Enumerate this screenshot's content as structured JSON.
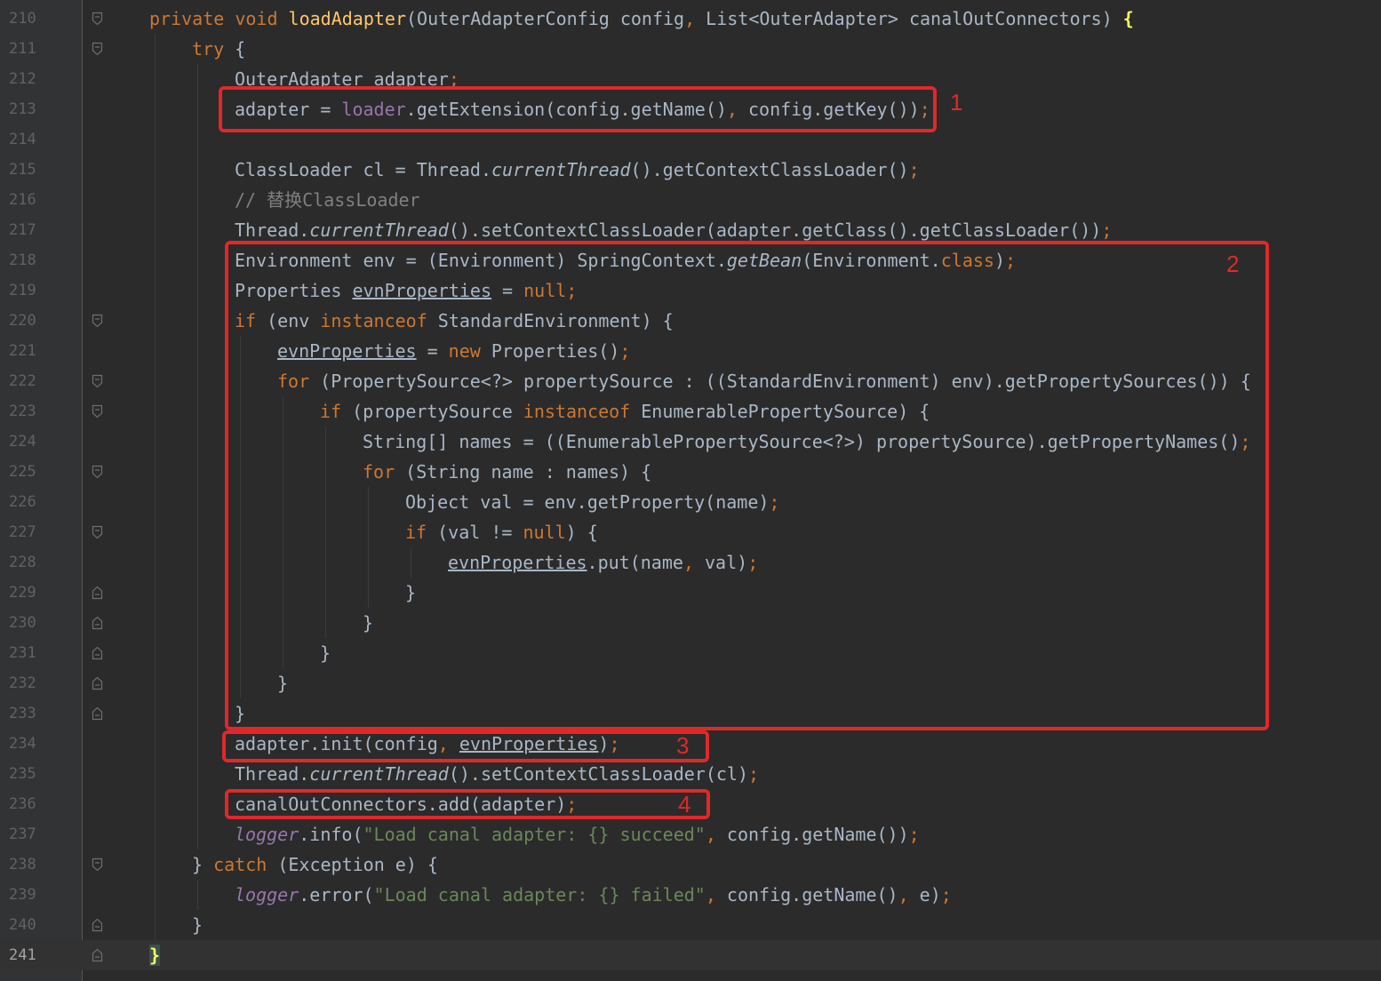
{
  "editor": {
    "theme_colors": {
      "background": "#2b2b2b",
      "keyword": "#cc7832",
      "method": "#ffc66d",
      "field": "#9876aa",
      "string": "#6a8759",
      "comment": "#808080",
      "annotation_box": "#e0282b"
    },
    "current_line": "241",
    "lines": [
      {
        "n": "210",
        "indent": 0,
        "tokens": [
          [
            "kw",
            "private "
          ],
          [
            "kw",
            "void "
          ],
          [
            "fn",
            "loadAdapter"
          ],
          [
            "p",
            "(OuterAdapterConfig config"
          ],
          [
            "kw",
            ", "
          ],
          [
            "p",
            "List<OuterAdapter> canalOutConnectors) "
          ],
          [
            "bh",
            "{"
          ]
        ]
      },
      {
        "n": "211",
        "indent": 1,
        "tokens": [
          [
            "kw",
            "try "
          ],
          [
            "p",
            "{"
          ]
        ]
      },
      {
        "n": "212",
        "indent": 2,
        "tokens": [
          [
            "p",
            "OuterAdapter adapter"
          ],
          [
            "kw",
            ";"
          ]
        ]
      },
      {
        "n": "213",
        "indent": 2,
        "tokens": [
          [
            "p",
            "adapter = "
          ],
          [
            "fld",
            "loader"
          ],
          [
            "p",
            ".getExtension(config.getName()"
          ],
          [
            "kw",
            ", "
          ],
          [
            "p",
            "config.getKey())"
          ],
          [
            "kw",
            ";"
          ]
        ]
      },
      {
        "n": "214",
        "indent": 2,
        "tokens": []
      },
      {
        "n": "215",
        "indent": 2,
        "tokens": [
          [
            "p",
            "ClassLoader cl = Thread."
          ],
          [
            "it",
            "currentThread"
          ],
          [
            "p",
            "().getContextClassLoader()"
          ],
          [
            "kw",
            ";"
          ]
        ]
      },
      {
        "n": "216",
        "indent": 2,
        "tokens": [
          [
            "cmt",
            "// 替换ClassLoader"
          ]
        ]
      },
      {
        "n": "217",
        "indent": 2,
        "tokens": [
          [
            "p",
            "Thread."
          ],
          [
            "it",
            "currentThread"
          ],
          [
            "p",
            "().setContextClassLoader(adapter.getClass().getClassLoader())"
          ],
          [
            "kw",
            ";"
          ]
        ]
      },
      {
        "n": "218",
        "indent": 2,
        "tokens": [
          [
            "p",
            "Environment env = (Environment) SpringContext."
          ],
          [
            "it",
            "getBean"
          ],
          [
            "p",
            "(Environment."
          ],
          [
            "kw",
            "class"
          ],
          [
            "p",
            ")"
          ],
          [
            "kw",
            ";"
          ]
        ]
      },
      {
        "n": "219",
        "indent": 2,
        "tokens": [
          [
            "p",
            "Properties "
          ],
          [
            "ul",
            "evnProperties"
          ],
          [
            "p",
            " = "
          ],
          [
            "kw",
            "null;"
          ]
        ]
      },
      {
        "n": "220",
        "indent": 2,
        "tokens": [
          [
            "kw",
            "if "
          ],
          [
            "p",
            "(env "
          ],
          [
            "kw",
            "instanceof "
          ],
          [
            "p",
            "StandardEnvironment) {"
          ]
        ]
      },
      {
        "n": "221",
        "indent": 3,
        "tokens": [
          [
            "ul",
            "evnProperties"
          ],
          [
            "p",
            " = "
          ],
          [
            "kw",
            "new "
          ],
          [
            "p",
            "Properties()"
          ],
          [
            "kw",
            ";"
          ]
        ]
      },
      {
        "n": "222",
        "indent": 3,
        "tokens": [
          [
            "kw",
            "for "
          ],
          [
            "p",
            "(PropertySource<?> propertySource : ((StandardEnvironment) env).getPropertySources()) {"
          ]
        ]
      },
      {
        "n": "223",
        "indent": 4,
        "tokens": [
          [
            "kw",
            "if "
          ],
          [
            "p",
            "(propertySource "
          ],
          [
            "kw",
            "instanceof "
          ],
          [
            "p",
            "EnumerablePropertySource) {"
          ]
        ]
      },
      {
        "n": "224",
        "indent": 5,
        "tokens": [
          [
            "p",
            "String[] names = ((EnumerablePropertySource<?>) propertySource).getPropertyNames()"
          ],
          [
            "kw",
            ";"
          ]
        ]
      },
      {
        "n": "225",
        "indent": 5,
        "tokens": [
          [
            "kw",
            "for "
          ],
          [
            "p",
            "(String name : names) {"
          ]
        ]
      },
      {
        "n": "226",
        "indent": 6,
        "tokens": [
          [
            "p",
            "Object val = env.getProperty(name)"
          ],
          [
            "kw",
            ";"
          ]
        ]
      },
      {
        "n": "227",
        "indent": 6,
        "tokens": [
          [
            "kw",
            "if "
          ],
          [
            "p",
            "(val != "
          ],
          [
            "kw",
            "null"
          ],
          [
            "p",
            ") {"
          ]
        ]
      },
      {
        "n": "228",
        "indent": 7,
        "tokens": [
          [
            "ul",
            "evnProperties"
          ],
          [
            "p",
            ".put(name"
          ],
          [
            "kw",
            ", "
          ],
          [
            "p",
            "val)"
          ],
          [
            "kw",
            ";"
          ]
        ]
      },
      {
        "n": "229",
        "indent": 6,
        "tokens": [
          [
            "p",
            "}"
          ]
        ]
      },
      {
        "n": "230",
        "indent": 5,
        "tokens": [
          [
            "p",
            "}"
          ]
        ]
      },
      {
        "n": "231",
        "indent": 4,
        "tokens": [
          [
            "p",
            "}"
          ]
        ]
      },
      {
        "n": "232",
        "indent": 3,
        "tokens": [
          [
            "p",
            "}"
          ]
        ]
      },
      {
        "n": "233",
        "indent": 2,
        "tokens": [
          [
            "p",
            "}"
          ]
        ]
      },
      {
        "n": "234",
        "indent": 2,
        "tokens": [
          [
            "p",
            "adapter.init(config"
          ],
          [
            "kw",
            ", "
          ],
          [
            "ul",
            "evnProperties"
          ],
          [
            "p",
            ")"
          ],
          [
            "kw",
            ";"
          ]
        ]
      },
      {
        "n": "235",
        "indent": 2,
        "tokens": [
          [
            "p",
            "Thread."
          ],
          [
            "it",
            "currentThread"
          ],
          [
            "p",
            "().setContextClassLoader(cl)"
          ],
          [
            "kw",
            ";"
          ]
        ]
      },
      {
        "n": "236",
        "indent": 2,
        "tokens": [
          [
            "p",
            "canalOutConnectors.add(adapter)"
          ],
          [
            "kw",
            ";"
          ]
        ]
      },
      {
        "n": "237",
        "indent": 2,
        "tokens": [
          [
            "itf",
            "logger"
          ],
          [
            "p",
            ".info("
          ],
          [
            "str",
            "\"Load canal adapter: {} succeed\""
          ],
          [
            "kw",
            ", "
          ],
          [
            "p",
            "config.getName())"
          ],
          [
            "kw",
            ";"
          ]
        ]
      },
      {
        "n": "238",
        "indent": 1,
        "tokens": [
          [
            "p",
            "} "
          ],
          [
            "kw",
            "catch "
          ],
          [
            "p",
            "(Exception e) {"
          ]
        ]
      },
      {
        "n": "239",
        "indent": 2,
        "tokens": [
          [
            "itf",
            "logger"
          ],
          [
            "p",
            ".error("
          ],
          [
            "str",
            "\"Load canal adapter: {} failed\""
          ],
          [
            "kw",
            ", "
          ],
          [
            "p",
            "config.getName()"
          ],
          [
            "kw",
            ", "
          ],
          [
            "p",
            "e)"
          ],
          [
            "kw",
            ";"
          ]
        ]
      },
      {
        "n": "240",
        "indent": 1,
        "tokens": [
          [
            "p",
            "}"
          ]
        ]
      },
      {
        "n": "241",
        "indent": 0,
        "tokens": [
          [
            "caret",
            "}"
          ]
        ]
      }
    ],
    "fold_markers": {
      "210": "open",
      "211": "open",
      "220": "open",
      "222": "open",
      "223": "open",
      "225": "open",
      "227": "open",
      "229": "close",
      "230": "close",
      "231": "close",
      "232": "close",
      "233": "close",
      "238": "open",
      "240": "close",
      "241": "close"
    }
  },
  "annotations": [
    {
      "label": "1"
    },
    {
      "label": "2"
    },
    {
      "label": "3"
    },
    {
      "label": "4"
    }
  ]
}
